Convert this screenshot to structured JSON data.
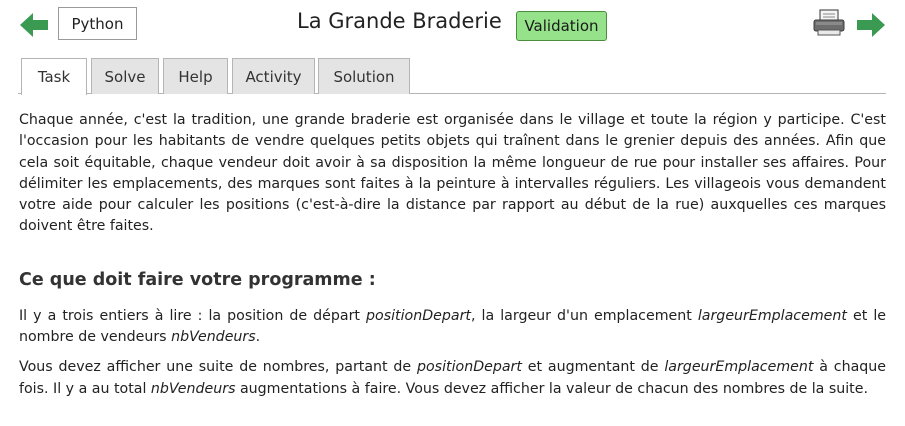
{
  "header": {
    "language_button": "Python",
    "title": "La Grande Braderie",
    "validation_badge": "Validation",
    "colors": {
      "arrow": "#3a9a52",
      "badge": "#96e28a"
    },
    "icons": {
      "prev": "arrow-left-icon",
      "next": "arrow-right-icon",
      "print": "printer-icon"
    }
  },
  "tabs": [
    {
      "label": "Task",
      "active": true
    },
    {
      "label": "Solve",
      "active": false
    },
    {
      "label": "Help",
      "active": false
    },
    {
      "label": "Activity",
      "active": false
    },
    {
      "label": "Solution",
      "active": false
    }
  ],
  "task": {
    "intro": "Chaque année, c'est la tradition, une grande braderie est organisée dans le village et toute la région y participe. C'est l'occasion pour les habitants de vendre quelques petits objets qui traînent dans le grenier depuis des années. Afin que cela soit équitable, chaque vendeur doit avoir à sa disposition la même longueur de rue pour installer ses affaires. Pour délimiter les emplacements, des marques sont faites à la peinture à intervalles réguliers. Les villageois vous demandent votre aide pour calculer les positions (c'est-à-dire la distance par rapport au début de la rue) auxquelles ces marques doivent être faites.",
    "heading": "Ce que doit faire votre programme :",
    "p1": {
      "t1": "Il y a trois entiers à lire : la position de départ ",
      "v1": "positionDepart",
      "t2": ", la largeur d'un emplacement ",
      "v2": "largeurEmplacement",
      "t3": " et le nombre de vendeurs ",
      "v3": "nbVendeurs",
      "t4": "."
    },
    "p2": {
      "t1": "Vous devez afficher une suite de nombres, partant de ",
      "v1": "positionDepart",
      "t2": " et augmentant de ",
      "v2": "largeurEmplacement",
      "t3": " à chaque fois. Il y a au total ",
      "v3": "nbVendeurs",
      "t4": " augmentations à faire. Vous devez afficher la valeur de chacun des nombres de la suite."
    }
  }
}
